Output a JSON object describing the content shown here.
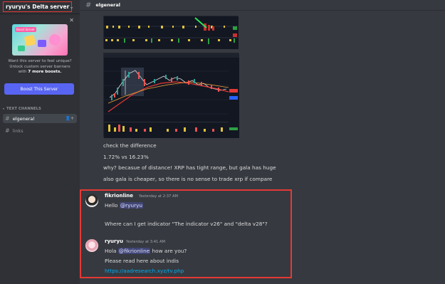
{
  "server": {
    "name": "ryuryu's Delta server"
  },
  "boost": {
    "banner_tag": "Boost Server",
    "line1": "Want this server to feel unique?",
    "line2": "Unlock custom server banners",
    "line3_pre": "with ",
    "line3_bold": "7 more boosts.",
    "button": "Boost This Server"
  },
  "channels": {
    "category": "TEXT CHANNELS",
    "items": [
      {
        "label": "elgeneral",
        "active": true
      },
      {
        "label": "links",
        "active": false
      }
    ]
  },
  "topbar": {
    "title": "elgeneral"
  },
  "messages": {
    "prior_lines": [
      "check the difference",
      "1.72% vs 16.23%",
      "why? becasue of distance! XRP has tight range, but gala has huge",
      "also gala is cheaper, so there is no sense to trade xrp if compare"
    ],
    "msg1": {
      "author": "fikrionline",
      "timestamp": "Yesterday at 2:37 AM",
      "line1_pre": "Hello ",
      "line1_mention": "@ryuryu",
      "line2": "Where can I get indicator \"The indicator v26\" and \"delta v28\"?"
    },
    "msg2": {
      "author": "ryuryu",
      "timestamp": "Yesterday at 3:41 AM",
      "line1_pre": "Hola ",
      "line1_mention": "@fikrionline",
      "line1_post": "  how are you?",
      "line2": "Please read here about indis",
      "link": "https://aadresearch.xyz/tv.php"
    }
  },
  "colors": {
    "accent": "#5865f2",
    "highlight": "#e53935",
    "link": "#00aff4"
  }
}
